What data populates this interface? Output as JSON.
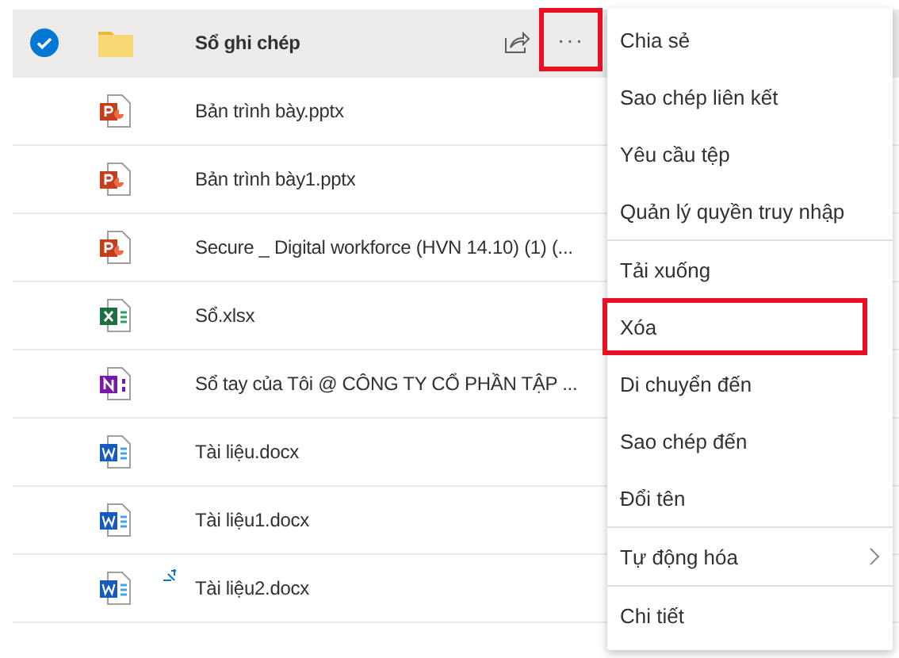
{
  "files": [
    {
      "name": "Sổ ghi chép",
      "kind": "folder",
      "selected": true,
      "is_new": false
    },
    {
      "name": "Bản trình bày.pptx",
      "kind": "pptx",
      "selected": false,
      "is_new": false
    },
    {
      "name": "Bản trình bày1.pptx",
      "kind": "pptx",
      "selected": false,
      "is_new": false
    },
    {
      "name": "Secure _ Digital workforce (HVN 14.10) (1) (...",
      "kind": "pptx",
      "selected": false,
      "is_new": false
    },
    {
      "name": "Sổ.xlsx",
      "kind": "xlsx",
      "selected": false,
      "is_new": false
    },
    {
      "name": "Sổ tay của Tôi @ CÔNG TY CỔ PHẦN TẬP ...",
      "kind": "onenote",
      "selected": false,
      "is_new": false
    },
    {
      "name": "Tài liệu.docx",
      "kind": "docx",
      "selected": false,
      "is_new": false
    },
    {
      "name": "Tài liệu1.docx",
      "kind": "docx",
      "selected": false,
      "is_new": false
    },
    {
      "name": "Tài liệu2.docx",
      "kind": "docx",
      "selected": false,
      "is_new": true
    }
  ],
  "more_button": {
    "label": "···",
    "highlighted": true
  },
  "context_menu": [
    {
      "label": "Chia sẻ",
      "highlighted": false,
      "divider_before": false,
      "submenu": false
    },
    {
      "label": "Sao chép liên kết",
      "highlighted": false,
      "divider_before": false,
      "submenu": false
    },
    {
      "label": "Yêu cầu tệp",
      "highlighted": false,
      "divider_before": false,
      "submenu": false
    },
    {
      "label": "Quản lý quyền truy nhập",
      "highlighted": false,
      "divider_before": false,
      "submenu": false
    },
    {
      "label": "Tải xuống",
      "highlighted": false,
      "divider_before": true,
      "submenu": false
    },
    {
      "label": "Xóa",
      "highlighted": true,
      "divider_before": false,
      "submenu": false
    },
    {
      "label": "Di chuyển đến",
      "highlighted": false,
      "divider_before": false,
      "submenu": false
    },
    {
      "label": "Sao chép đến",
      "highlighted": false,
      "divider_before": false,
      "submenu": false
    },
    {
      "label": "Đổi tên",
      "highlighted": false,
      "divider_before": false,
      "submenu": false
    },
    {
      "label": "Tự động hóa",
      "highlighted": false,
      "divider_before": true,
      "submenu": true
    },
    {
      "label": "Chi tiết",
      "highlighted": false,
      "divider_before": true,
      "submenu": false
    }
  ]
}
